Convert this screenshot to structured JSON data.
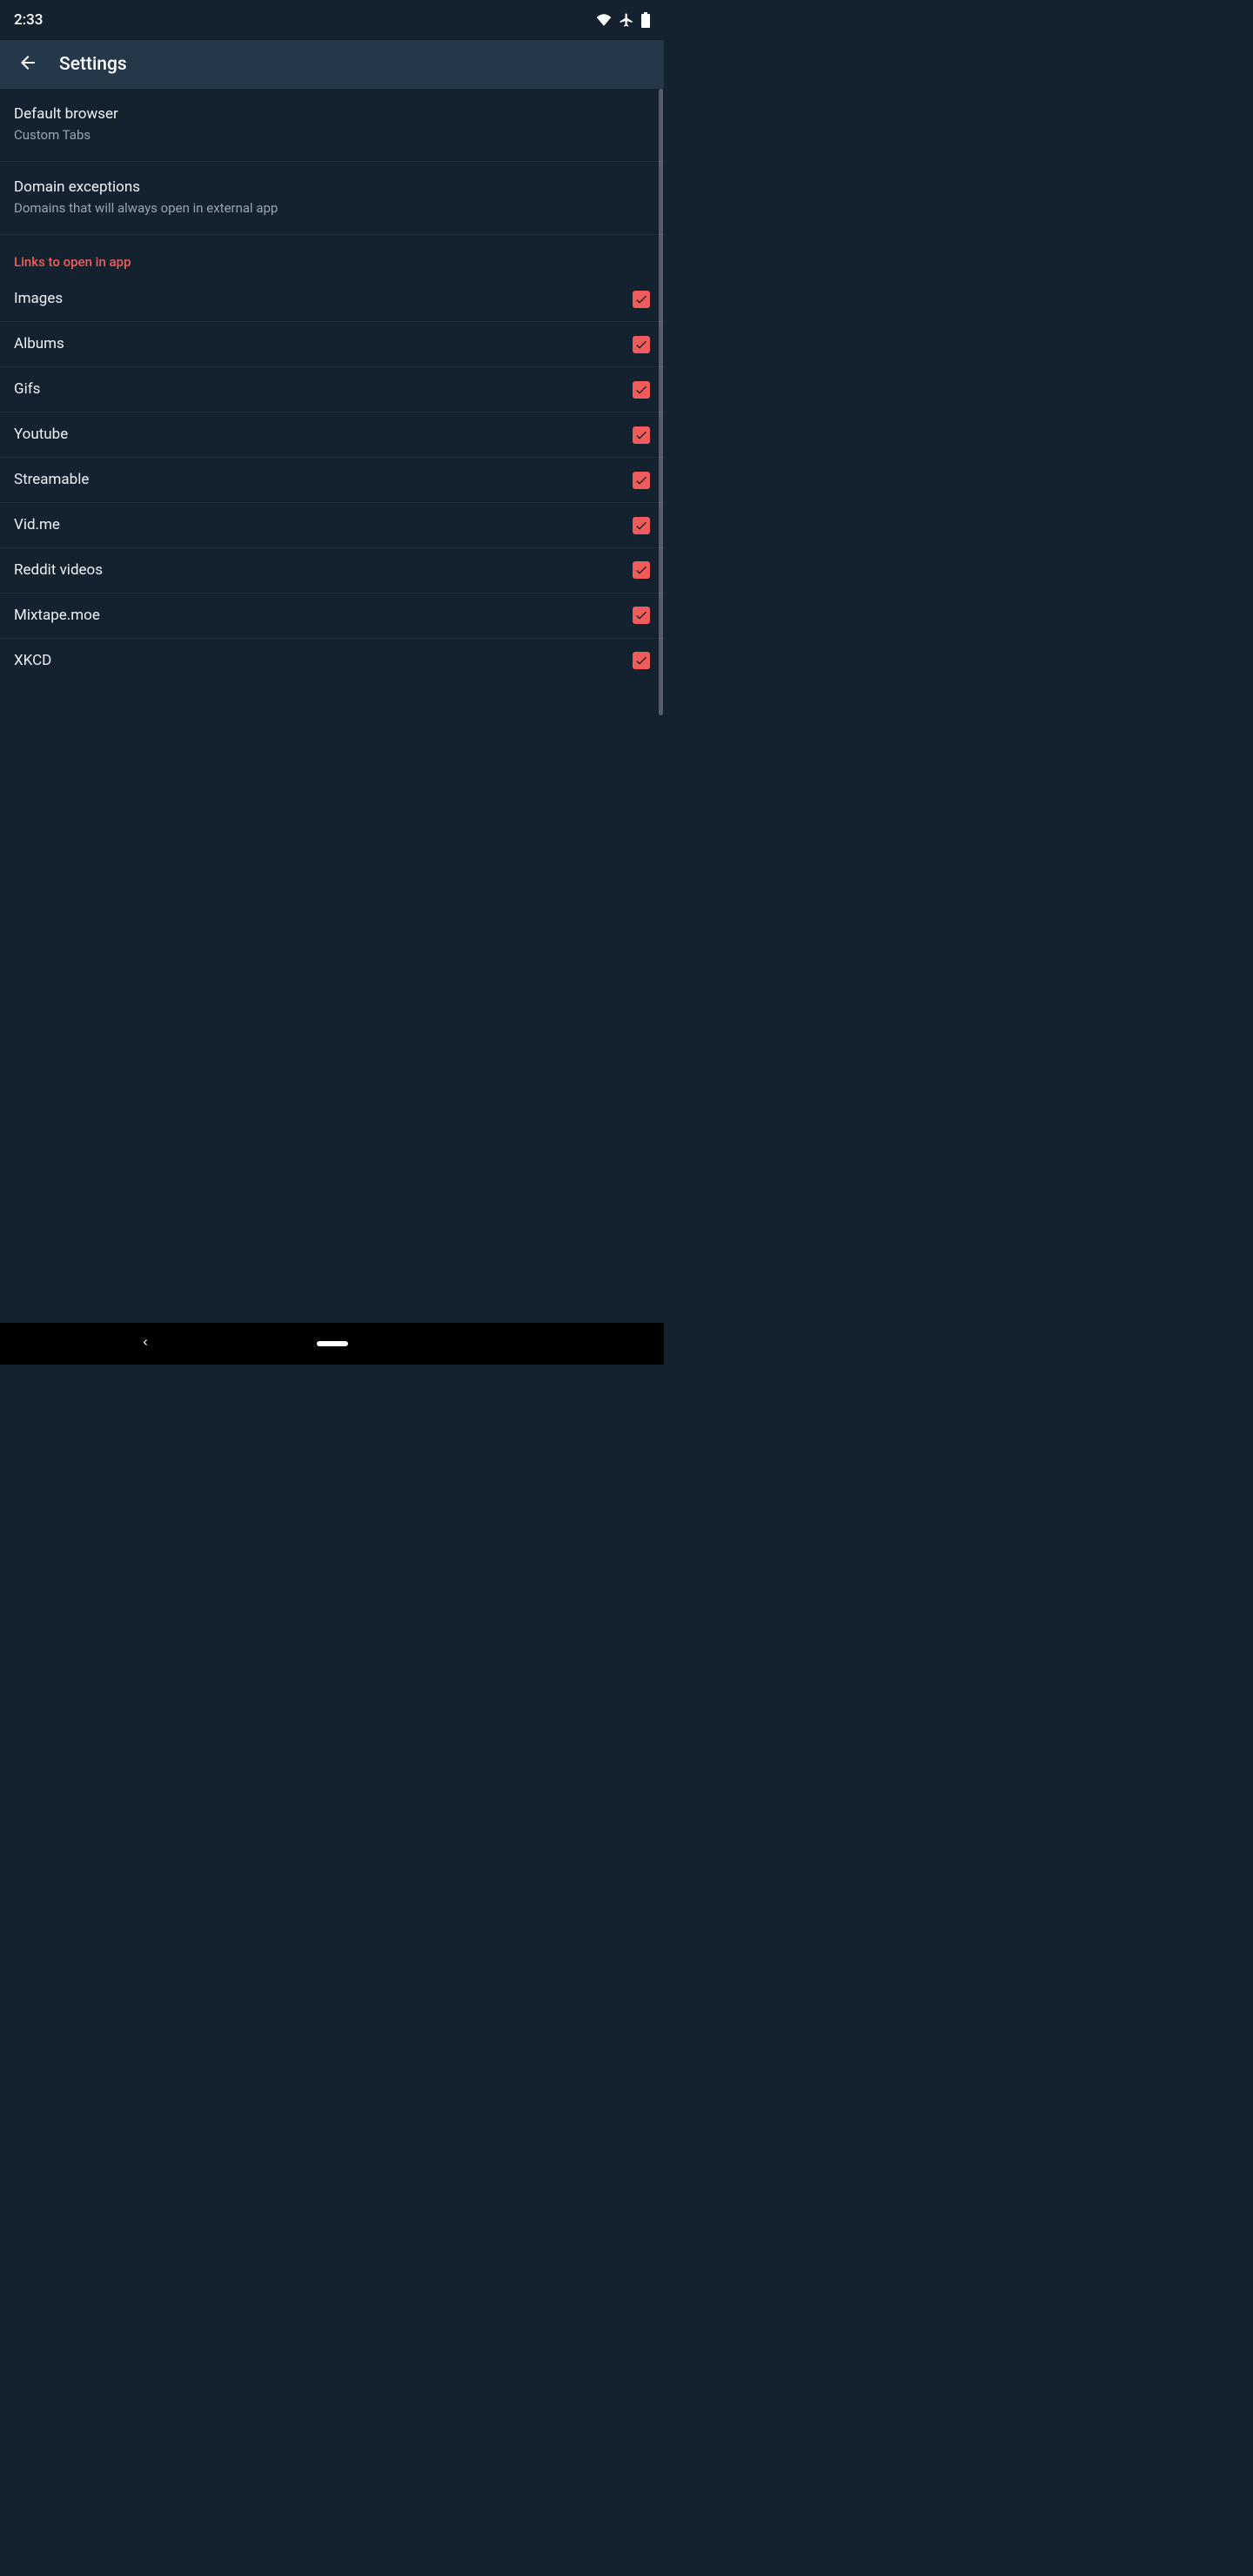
{
  "status": {
    "time": "2:33"
  },
  "toolbar": {
    "title": "Settings"
  },
  "prefs": {
    "default_browser": {
      "title": "Default browser",
      "value": "Custom Tabs"
    },
    "domain_exceptions": {
      "title": "Domain exceptions",
      "summary": "Domains that will always open in external app"
    }
  },
  "section": {
    "links_to_open": "Links to open in app"
  },
  "link_items": [
    {
      "label": "Images",
      "checked": true
    },
    {
      "label": "Albums",
      "checked": true
    },
    {
      "label": "Gifs",
      "checked": true
    },
    {
      "label": "Youtube",
      "checked": true
    },
    {
      "label": "Streamable",
      "checked": true
    },
    {
      "label": "Vid.me",
      "checked": true
    },
    {
      "label": "Reddit videos",
      "checked": true
    },
    {
      "label": "Mixtape.moe",
      "checked": true
    },
    {
      "label": "XKCD",
      "checked": true
    }
  ],
  "colors": {
    "accent": "#f05c5c",
    "bg": "#14212e",
    "toolbar": "#24384a"
  }
}
